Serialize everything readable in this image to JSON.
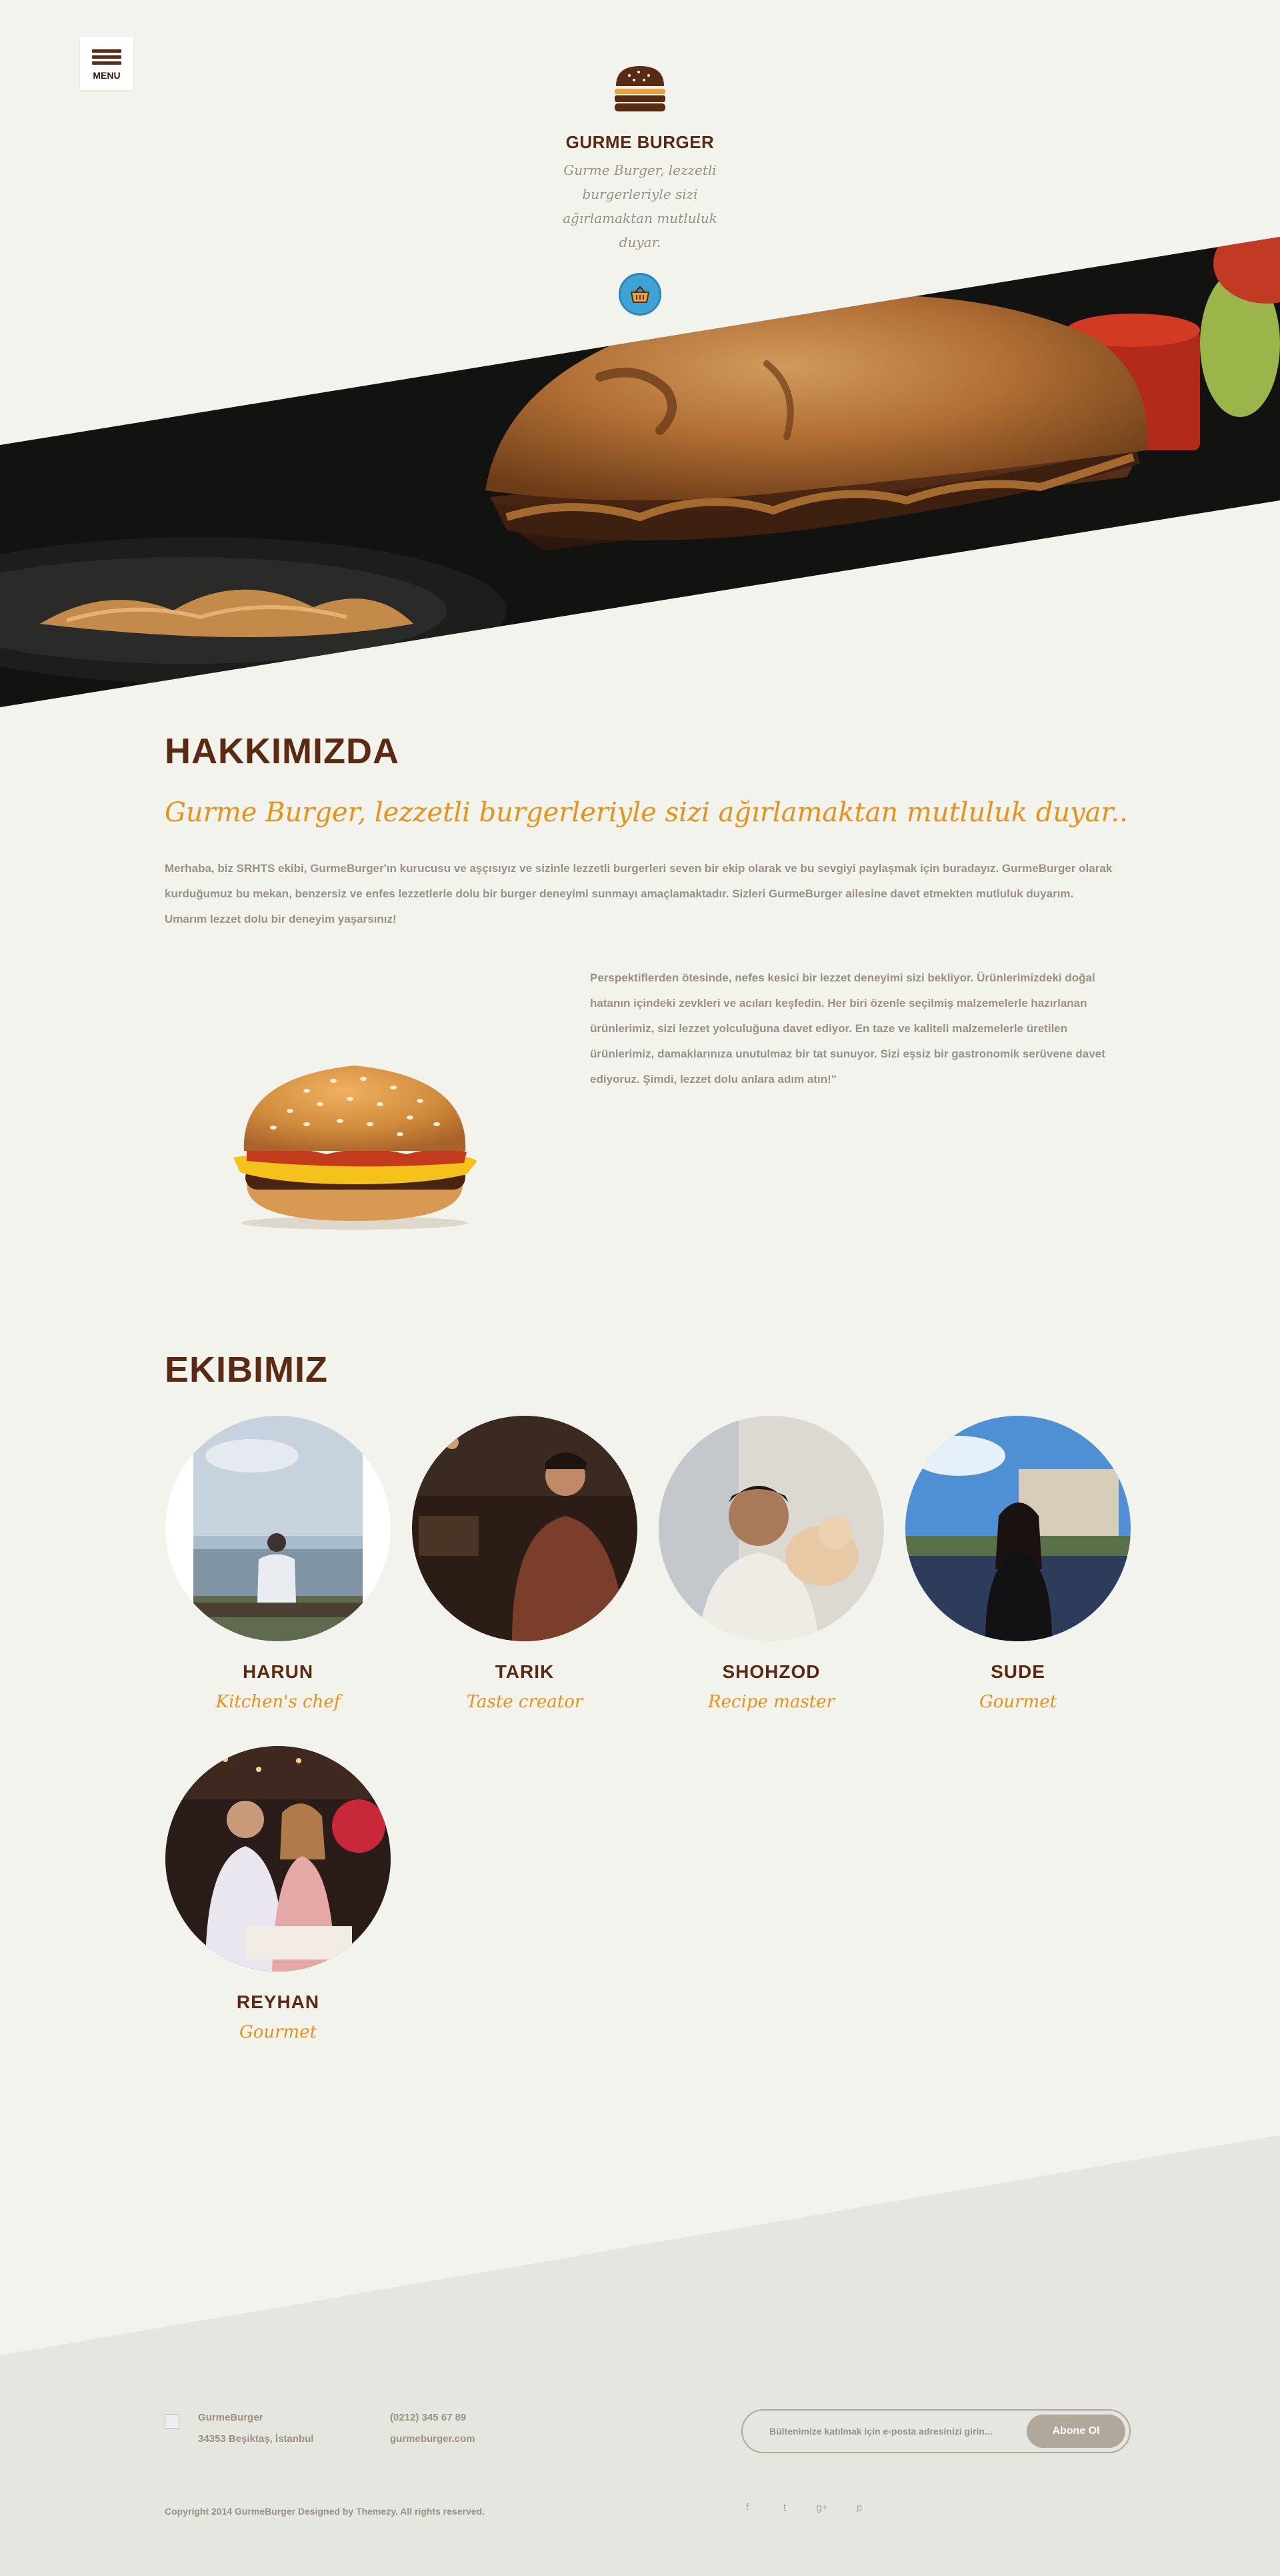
{
  "header": {
    "menu_label": "MENU",
    "brand_name": "GURME BURGER",
    "tagline": "Gurme Burger, lezzetli burgerleriyle sizi ağırlamaktan mutluluk duyar."
  },
  "about": {
    "title": "HAKKIMIZDA",
    "subtitle": "Gurme Burger, lezzetli burgerleriyle sizi ağırlamaktan mutluluk duyar..",
    "paragraph1": "Merhaba, biz SRHTS ekibi, GurmeBurger'ın kurucusu ve aşçısıyız ve sizinle lezzetli burgerleri seven bir ekip olarak ve bu sevgiyi paylaşmak için buradayız. GurmeBurger olarak kurduğumuz bu mekan, benzersiz ve enfes lezzetlerle dolu bir burger deneyimi sunmayı amaçlamaktadır. Sizleri GurmeBurger ailesine davet etmekten mutluluk duyarım. Umarım lezzet dolu bir deneyim yaşarsınız!",
    "paragraph2": "Perspektiflerden ötesinde, nefes kesici bir lezzet deneyimi sizi bekliyor. Ürünlerimizdeki doğal hatanın içindeki zevkleri ve acıları keşfedin. Her biri özenle seçilmiş malzemelerle hazırlanan ürünlerimiz, sizi lezzet yolculuğuna davet ediyor. En taze ve kaliteli malzemelerle üretilen ürünlerimiz, damaklarınıza unutulmaz bir tat sunuyor. Sizi eşsiz bir gastronomik serüvene davet ediyoruz. Şimdi, lezzet dolu anlara adım atın!\""
  },
  "team": {
    "title": "EKIBIMIZ",
    "members": [
      {
        "name": "HARUN",
        "role": "Kitchen's chef"
      },
      {
        "name": "TARIK",
        "role": "Taste creator"
      },
      {
        "name": "SHOHZOD",
        "role": "Recipe master"
      },
      {
        "name": "SUDE",
        "role": "Gourmet"
      },
      {
        "name": "REYHAN",
        "role": "Gourmet"
      }
    ]
  },
  "footer": {
    "company": "GurmeBurger",
    "address": "34353 Beşiktaş, İstanbul",
    "phone": "(0212) 345 67 89",
    "website": "gurmeburger.com",
    "newsletter_placeholder": "Bültenimize katılmak için e-posta adresinizi girin...",
    "subscribe_label": "Abone Ol",
    "copyright": "Copyright 2014 GurmeBurger Designed by Themezy. All rights reserved.",
    "socials": [
      "f",
      "t",
      "g+",
      "p"
    ]
  },
  "colors": {
    "background": "#f3f3ee",
    "heading": "#5a2a12",
    "accent": "#e8921a",
    "text": "#9b9182",
    "cart": "#3da3d5"
  },
  "icons": {
    "menu": "hamburger-icon",
    "logo": "burger-logo-icon",
    "cart": "basket-icon",
    "social": [
      "facebook-icon",
      "twitter-icon",
      "google-plus-icon",
      "pinterest-icon"
    ]
  }
}
